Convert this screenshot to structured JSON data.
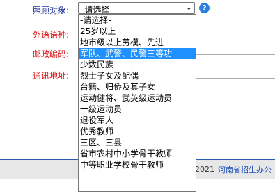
{
  "form": {
    "care_label": "照顾对象:",
    "lang_label": "外语语种:",
    "zip_label": "邮政编码:",
    "addr_label": "通讯地址:",
    "select_value": "-请选择-",
    "help_glyph": "?"
  },
  "dropdown": {
    "options": [
      "-请选择-",
      "25岁以上",
      "地市级以上劳模、先进",
      "军队、武警、民警三等功",
      "少数民族",
      "烈士子女及配偶",
      "台籍、归侨及其子女",
      "运动健将、武英级运动员",
      "一级运动员",
      "退役军人",
      "优秀教师",
      "三区、三县",
      "省市农村中小学骨干教师",
      "中等职业学校骨干教师"
    ],
    "selected_index": 3
  },
  "footer": {
    "copyright": "-2021",
    "org": "河南省招生办公"
  },
  "colors": {
    "highlight": "#1e90ff",
    "required_label": "#dd1111",
    "label_blue": "#1a2a99",
    "footer_bar": "#2c5fb0"
  }
}
